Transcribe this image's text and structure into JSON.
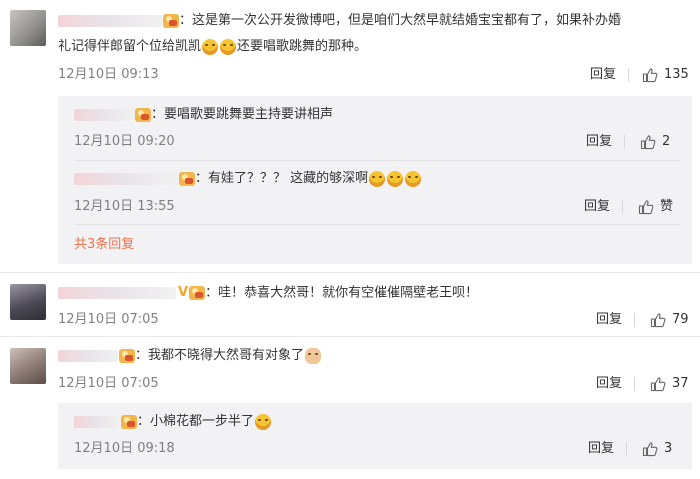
{
  "comments": [
    {
      "text_line1": "这是第一次公开发微博吧，但是咱们大然早就结婚宝宝都有了，如果补办婚",
      "text_line2_a": "礼记得伴郎留个位给凯凯",
      "text_line2_b": "还要唱歌跳舞的那种。",
      "time": "12月10日 09:13",
      "reply_label": "回复",
      "likes": "135",
      "replies": [
        {
          "text": "要唱歌要跳舞要主持要讲相声",
          "time": "12月10日 09:20",
          "reply_label": "回复",
          "likes": "2"
        },
        {
          "text": "有娃了？？？ 这藏的够深啊",
          "time": "12月10日 13:55",
          "reply_label": "回复",
          "likes": "赞"
        }
      ],
      "more_replies": "共3条回复"
    },
    {
      "text": "哇！恭喜大然哥！就你有空催催隔壁老王呗！",
      "time": "12月10日 07:05",
      "reply_label": "回复",
      "likes": "79"
    },
    {
      "text": "我都不晓得大然哥有对象了",
      "time": "12月10日 07:05",
      "reply_label": "回复",
      "likes": "37",
      "replies": [
        {
          "text": "小棉花都一步半了",
          "time": "12月10日 09:18",
          "reply_label": "回复",
          "likes": "3"
        }
      ]
    }
  ],
  "colors": {
    "link": "#eb7350",
    "reply_bg": "#f2f2f5",
    "meta_text": "#808080",
    "vip": "#f5a623"
  },
  "icons": [
    "like-thumb-icon",
    "user-badge-icon",
    "emoji-icon",
    "vip-v-icon"
  ]
}
